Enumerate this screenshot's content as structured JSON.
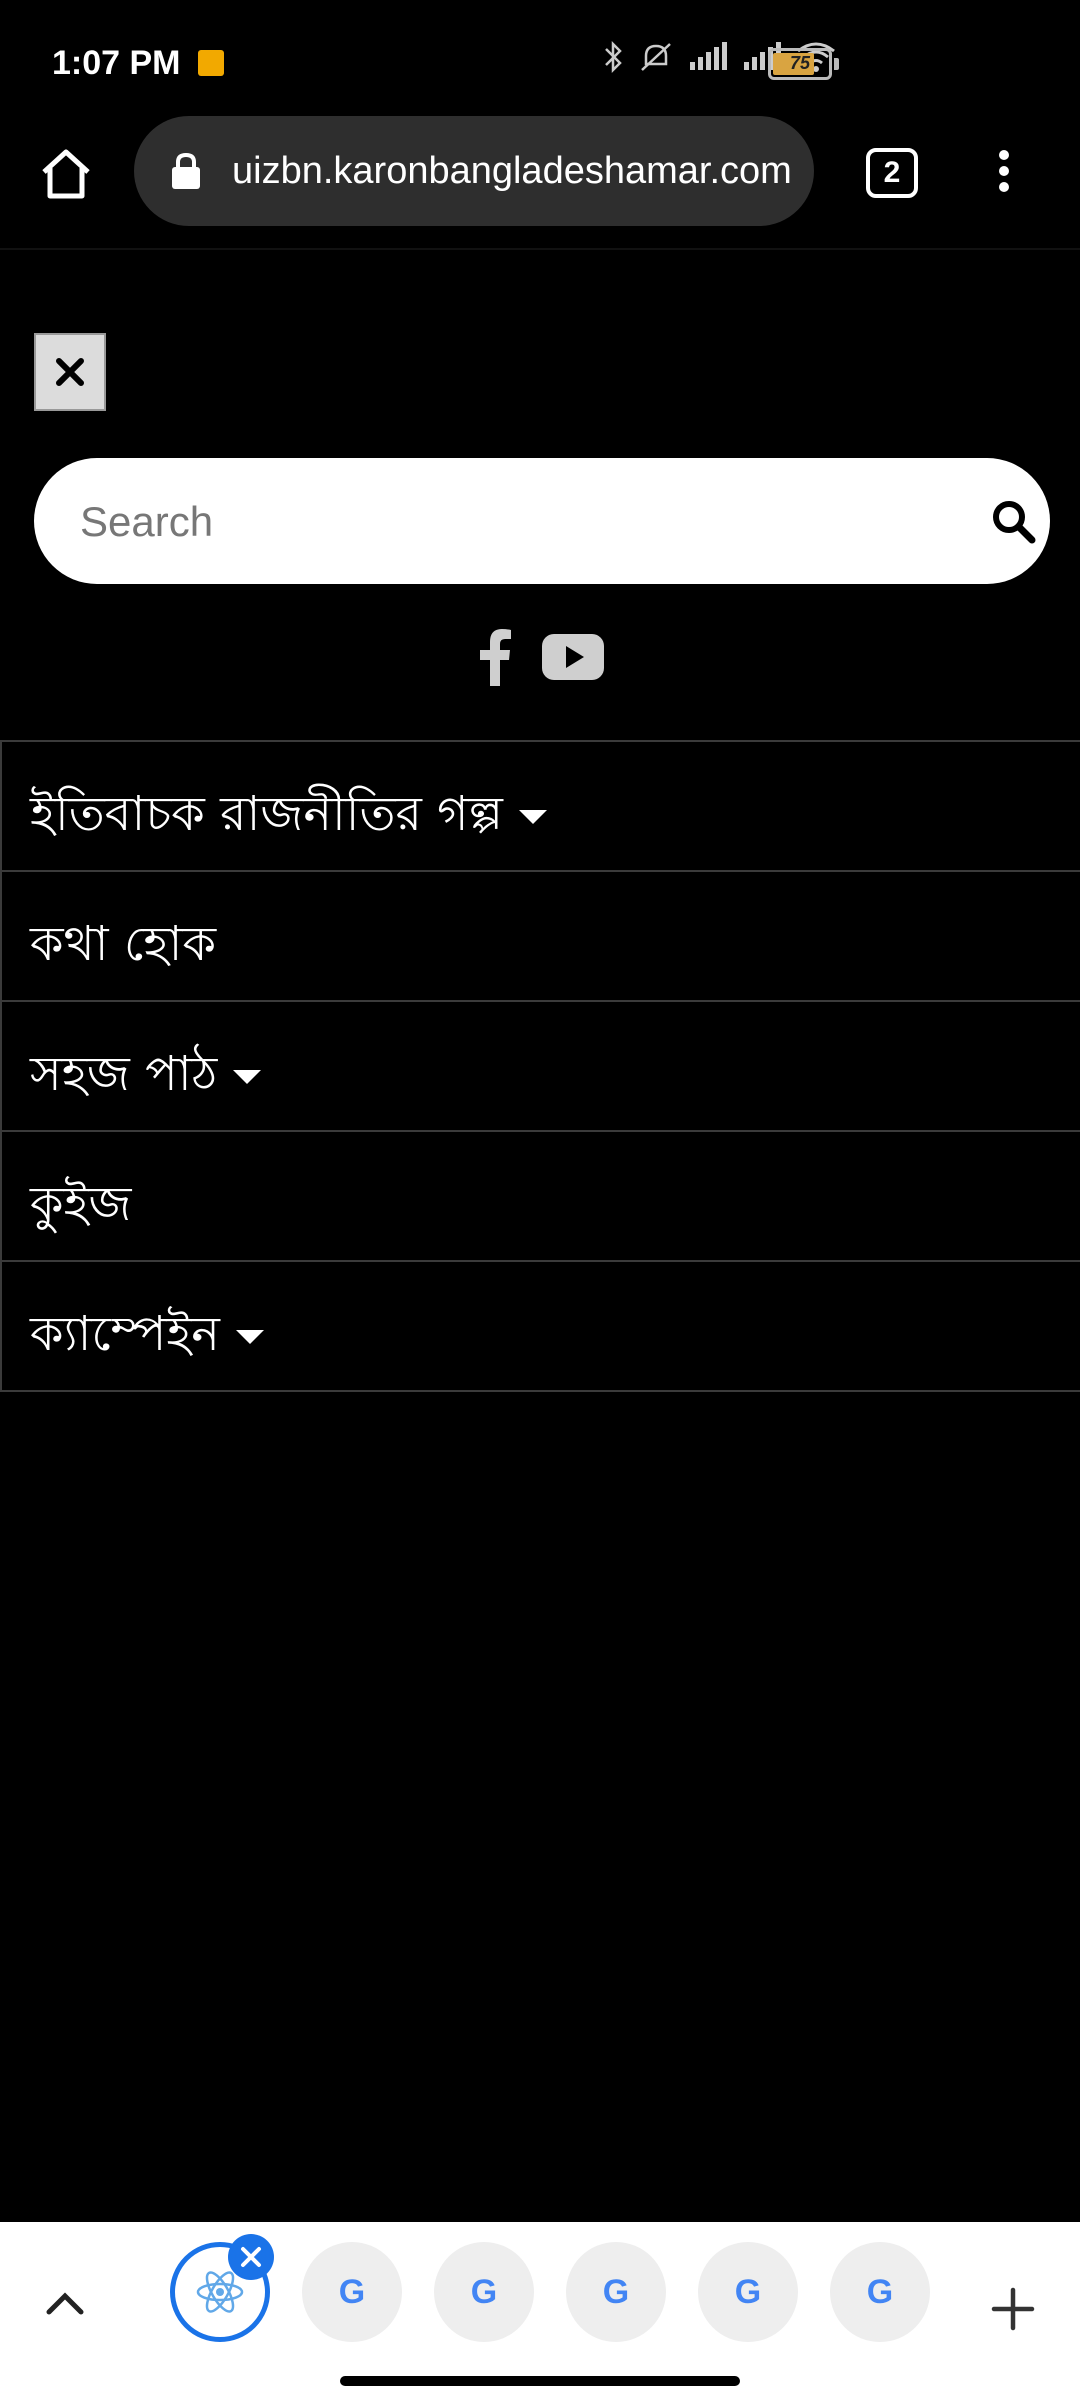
{
  "status_bar": {
    "time": "1:07 PM",
    "battery": "75",
    "battery_level": 0.75
  },
  "browser": {
    "url": "uizbn.karonbangladeshamar.com",
    "tab_count": "2"
  },
  "search": {
    "placeholder": "Search"
  },
  "menu": {
    "items": [
      {
        "label": "ইতিবাচক রাজনীতির গল্প",
        "has_dropdown": true
      },
      {
        "label": "কথা হোক",
        "has_dropdown": false
      },
      {
        "label": "সহজ পাঠ",
        "has_dropdown": true
      },
      {
        "label": "কুইজ",
        "has_dropdown": false
      },
      {
        "label": "ক্যাম্পেইন",
        "has_dropdown": true
      }
    ]
  },
  "tab_strip": {
    "active_tab_icon": "react-atom-icon",
    "other_tab_icons": [
      "google-icon",
      "google-icon",
      "google-icon",
      "google-icon",
      "google-icon"
    ],
    "accent_color": "#1a73e8"
  },
  "icons": [
    "home-icon",
    "lock-icon",
    "close-icon",
    "search-icon",
    "facebook-icon",
    "youtube-icon",
    "chevron-up-icon",
    "plus-icon"
  ]
}
